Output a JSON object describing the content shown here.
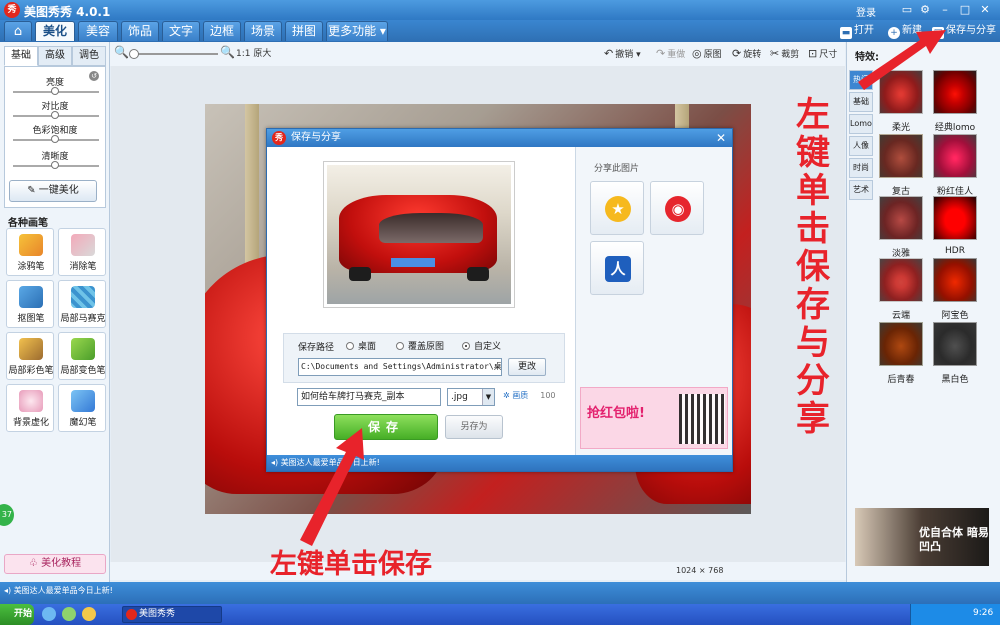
{
  "app": {
    "title": "美图秀秀 4.0.1",
    "login": "登录"
  },
  "tabs": [
    "美化",
    "美容",
    "饰品",
    "文字",
    "边框",
    "场景",
    "拼图",
    "更多功能"
  ],
  "top_actions": {
    "open": "打开",
    "new": "新建",
    "save_share": "保存与分享"
  },
  "toolbar": {
    "actual_size": "1:1 原大",
    "undo": "撤销",
    "redo": "重做",
    "original": "原图",
    "rotate": "旋转",
    "crop": "裁剪",
    "resize": "尺寸"
  },
  "left_panel": {
    "subtabs": [
      "基础",
      "高级",
      "调色"
    ],
    "adjustments": [
      "亮度",
      "对比度",
      "色彩饱和度",
      "清晰度"
    ],
    "one_key": "一键美化",
    "brush_title": "各种画笔",
    "brushes": [
      "涂鸦笔",
      "消除笔",
      "抠图笔",
      "局部马赛克",
      "局部彩色笔",
      "局部变色笔",
      "背景虚化",
      "魔幻笔"
    ],
    "tutorial": "美化教程",
    "bubble": "37"
  },
  "dialog": {
    "title": "保存与分享",
    "path_label": "保存路径",
    "radio_options": [
      "桌面",
      "覆盖原图",
      "自定义"
    ],
    "selected_radio": "自定义",
    "path_value": "C:\\Documents and Settings\\Administrator\\桌",
    "change_button": "更改",
    "filename_value": "如何给车牌打马赛克_副本",
    "extension": ".jpg",
    "quality_label": "画质",
    "quality_value": "100",
    "save_button": "保存",
    "save_as_button": "另存为",
    "share_title": "分享此图片",
    "status_text": "美图达人最爱单品今日上新!",
    "promo_text": "抢红包啦!"
  },
  "right_panel": {
    "effects_label": "特效:",
    "vtabs": [
      "热门",
      "基础",
      "Lomo",
      "人像",
      "时尚",
      "艺术"
    ],
    "effects": [
      "柔光",
      "经典lomo",
      "复古",
      "粉红佳人",
      "淡雅",
      "HDR",
      "云端",
      "阿宝色",
      "后青春",
      "黑白色"
    ],
    "ad_text": "优自合体 暗易凹凸"
  },
  "canvas": {
    "size_width": "1024",
    "size_sep": "×",
    "size_height": "768"
  },
  "statusbar": {
    "text": "美图达人最爱单品今日上新!"
  },
  "taskbar": {
    "start": "开始",
    "app": "美图秀秀",
    "clock": "9:26"
  },
  "annotations": {
    "right": "左键单击保存与分享",
    "bottom": "左键单击保存"
  },
  "colors": {
    "accent": "#2f79c4",
    "save_green": "#46ae26",
    "annotation_red": "#e8232b"
  }
}
